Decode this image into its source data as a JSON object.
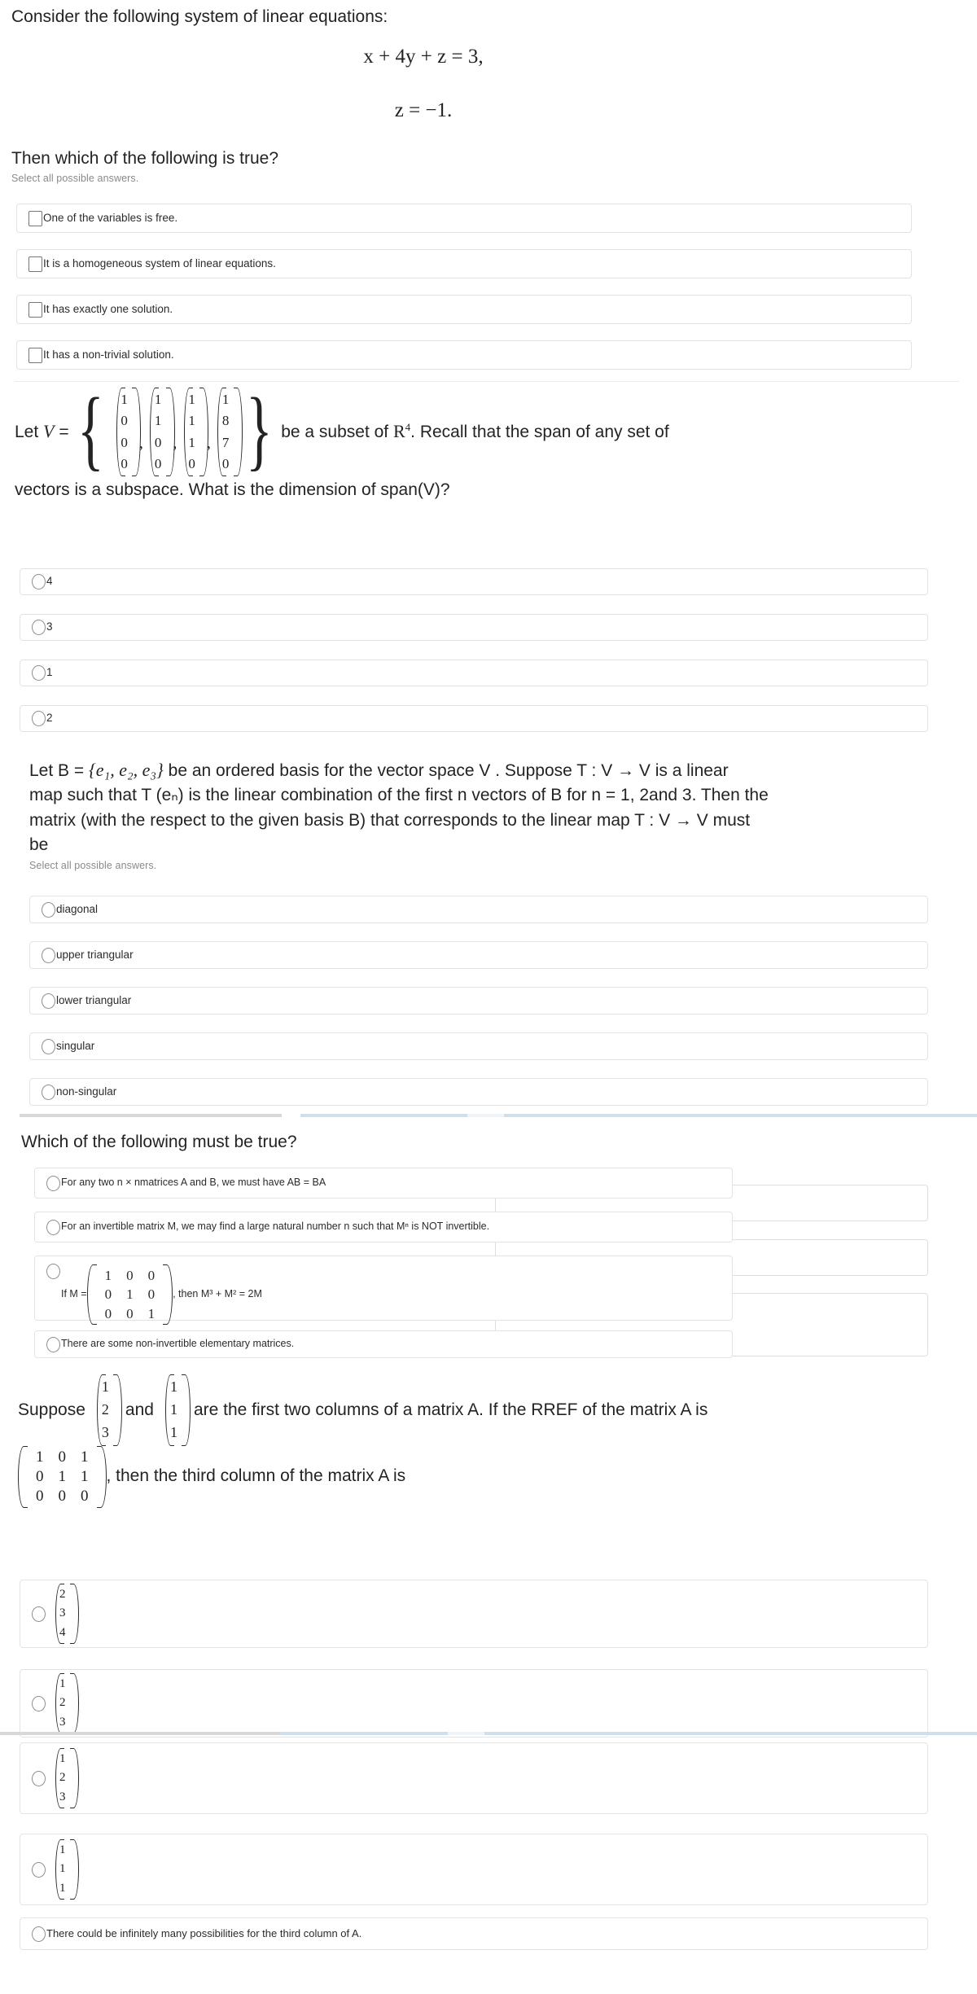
{
  "questions": [
    {
      "id": "q1",
      "intro": "Consider the following system of linear equations:",
      "equations": [
        "x + 4y + z = 3,",
        "z = −1."
      ],
      "prompt": "Then which of the following is true?",
      "hint": "Select all possible answers.",
      "input_type": "checkbox",
      "options": [
        "One of the variables is free.",
        "It is a homogeneous system of linear equations.",
        "It has exactly one solution.",
        "It has a non-trivial solution."
      ]
    },
    {
      "id": "q2",
      "stem_parts": {
        "lead": "Let V =",
        "tail": "be a subset of R",
        "tail_sup": "4",
        "tail2": ". Recall that the span of any set of",
        "line2": "vectors is a subspace. What is the dimension of span(V)?"
      },
      "vectors": [
        [
          "1",
          "0",
          "0",
          "0"
        ],
        [
          "1",
          "1",
          "0",
          "0"
        ],
        [
          "1",
          "1",
          "1",
          "0"
        ],
        [
          "1",
          "8",
          "7",
          "0"
        ]
      ],
      "input_type": "radio",
      "options": [
        "4",
        "3",
        "1",
        "2"
      ]
    },
    {
      "id": "q3",
      "stem_line1_a": "Let B =",
      "stem_line1_set": "{e₁, e₂, e₃}",
      "stem_line1_b": "be an ordered basis for the vector space V . Suppose T : V → V  is a linear",
      "stem_line2": "map such that T (eₙ) is the linear combination of the first n vectors of B for n = 1, 2and 3. Then the",
      "stem_line3": "matrix (with the respect to the given basis B) that corresponds to the linear map T : V → V  must",
      "stem_line4": "be",
      "hint": "Select all possible answers.",
      "input_type": "radio",
      "options": [
        "diagonal",
        "upper triangular",
        "lower triangular",
        "singular",
        "non-singular"
      ]
    },
    {
      "id": "q4",
      "prompt": "Which of the following must be true?",
      "input_type": "radio",
      "options": [
        {
          "kind": "text",
          "text": "For any two n × nmatrices A and B, we must have AB = BA"
        },
        {
          "kind": "text",
          "text": "For an invertible matrix M, we may find a large natural number n such that Mⁿ is NOT invertible."
        },
        {
          "kind": "matrix",
          "prefix": "If M =",
          "matrix": [
            [
              "1",
              "0",
              "0"
            ],
            [
              "0",
              "1",
              "0"
            ],
            [
              "0",
              "0",
              "1"
            ]
          ],
          "suffix": ", then M³ + M² = 2M"
        },
        {
          "kind": "text",
          "text": "There are some non-invertible elementary matrices."
        }
      ]
    },
    {
      "id": "q5",
      "stem_prefix": "Suppose",
      "col1": [
        "1",
        "2",
        "3"
      ],
      "stem_and": "and",
      "col2": [
        "1",
        "1",
        "1"
      ],
      "stem_mid": "are the first two columns of a matrix A. If the RREF of the matrix A is",
      "rref": [
        [
          "1",
          "0",
          "1"
        ],
        [
          "0",
          "1",
          "1"
        ],
        [
          "0",
          "0",
          "0"
        ]
      ],
      "stem_tail": ", then the third column of the matrix A is",
      "input_type": "radio",
      "options": [
        {
          "kind": "vector",
          "values": [
            "2",
            "3",
            "4"
          ]
        },
        {
          "kind": "vector",
          "values": [
            "1",
            "2",
            "3"
          ]
        },
        {
          "kind": "vector",
          "values": [
            "1",
            "2",
            "3"
          ]
        },
        {
          "kind": "vector",
          "values": [
            "1",
            "1",
            "1"
          ]
        },
        {
          "kind": "text",
          "text": "There could be infinitely many possibilities for the third column of A."
        }
      ]
    }
  ],
  "colors": {
    "box_border": "#e3e3e3",
    "text": "#232323",
    "hint": "#8a8a8a",
    "bar_blue": "#cfe0ec",
    "bar_grey": "#d8d8d8",
    "bar_pale": "#eef4f8"
  }
}
